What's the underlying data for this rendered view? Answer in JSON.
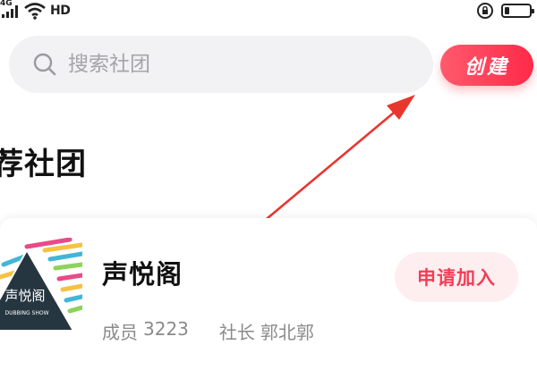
{
  "status_bar": {
    "network_label": "4G",
    "hd_label": "HD",
    "icons": [
      "signal-icon",
      "wifi-icon",
      "rotation-lock-icon",
      "battery-icon"
    ]
  },
  "search": {
    "placeholder": "搜索社团"
  },
  "create_button": {
    "label": "创建"
  },
  "section": {
    "title": "荐社团"
  },
  "club": {
    "name": "声悦阁",
    "logo_text": "声悦阁",
    "logo_subtext": "DUBBING SHOW",
    "members_label": "成员",
    "members_count": "3223",
    "leader_label": "社长",
    "leader_name": "郭北郭",
    "join_label": "申请加入"
  },
  "colors": {
    "accent": "#ff3a55",
    "annotation_arrow": "#e8362f",
    "search_bg": "#f2f2f4",
    "join_bg": "#ffeef0"
  }
}
